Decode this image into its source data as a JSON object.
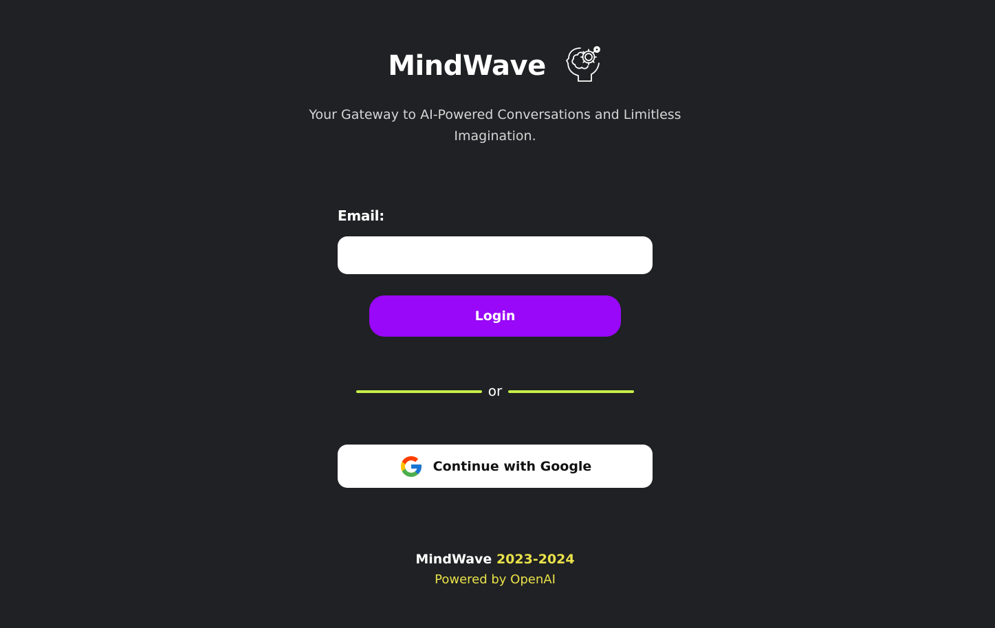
{
  "header": {
    "title": "MindWave",
    "icon": "brain-gear-icon",
    "tagline": "Your Gateway to AI-Powered Conversations and Limitless Imagination."
  },
  "form": {
    "email_label": "Email:",
    "email_value": "",
    "email_placeholder": "",
    "login_label": "Login",
    "divider_text": "or",
    "google_label": "Continue with Google",
    "google_icon": "google-icon"
  },
  "footer": {
    "brand": "MindWave",
    "years": "2023-2024",
    "powered_by": "Powered by OpenAI"
  },
  "colors": {
    "background": "#202124",
    "login_button": "#9908f9",
    "divider": "#c5f04a",
    "accent_yellow": "#e9e24a"
  }
}
